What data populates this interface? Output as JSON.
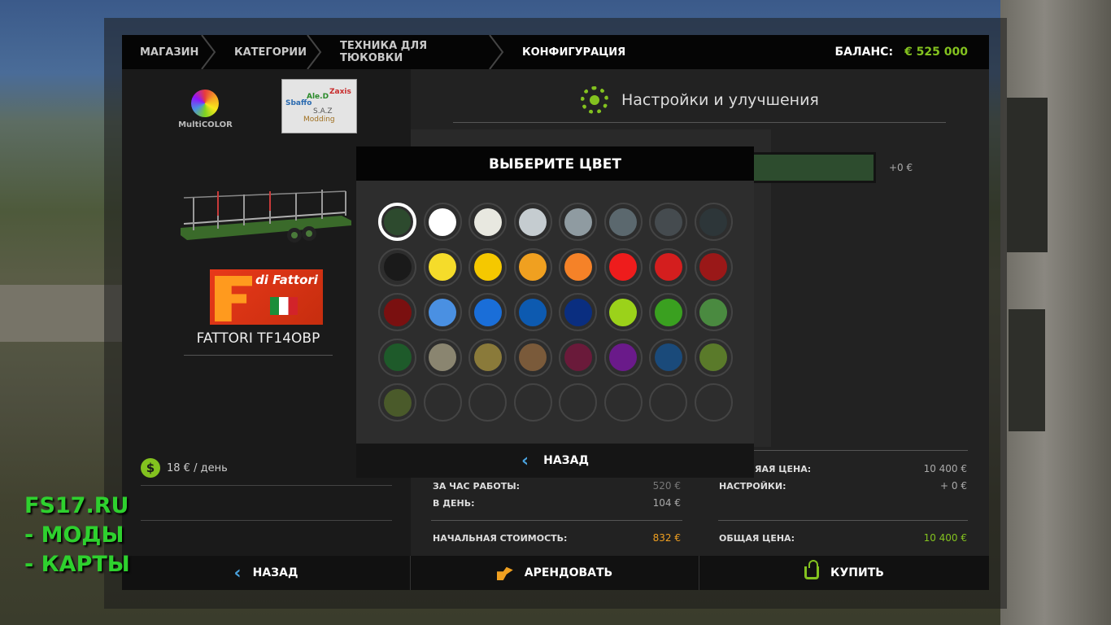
{
  "breadcrumbs": [
    "МАГАЗИН",
    "КАТЕГОРИИ",
    "ТЕХНИКА ДЛЯ ТЮКОВКИ",
    "КОНФИГУРАЦИЯ"
  ],
  "balance": {
    "label": "БАЛАНС:",
    "value": "€ 525 000"
  },
  "left": {
    "multicolor_logo": "MultiCOLOR",
    "sb_logo": [
      "Sbaffo",
      "Ale.D",
      "Zaxis",
      "S.A.Z",
      "Modding"
    ],
    "brand_logo": "di Fattori",
    "vehicle_name": "FATTORI TF14OBP",
    "per_day": "18 € / день"
  },
  "settings": {
    "title": "Настройки и улучшения",
    "price_delta": "+0 €"
  },
  "costs": {
    "per_hour_label": "ЗА ЧАС РАБОТЫ:",
    "per_hour_value": "520 €",
    "per_day_label": "В ДЕНЬ:",
    "per_day_value": "104 €",
    "initial_label": "НАЧАЛЬНАЯ СТОИМОСТЬ:",
    "initial_value": "832 €",
    "base_price_label": "ЯАЯ ЦЕНА:",
    "base_price_value": "10 400 €",
    "config_label": "НАСТРОЙКИ:",
    "config_value": "+ 0 €",
    "total_label": "ОБЩАЯ ЦЕНА:",
    "total_value": "10 400 €"
  },
  "color_picker": {
    "title": "ВЫБЕРИТЕ ЦВЕТ",
    "back_label": "НАЗАД",
    "selected_index": 0,
    "colors": [
      "#2d4a2e",
      "#ffffff",
      "#e8e8e0",
      "#c5ccd0",
      "#8f9ba1",
      "#5b686e",
      "#454b4f",
      "#2d3639",
      "#1a1a1a",
      "#f5dc2a",
      "#f5c800",
      "#f0a020",
      "#f58228",
      "#ee1c1c",
      "#d41e1e",
      "#9a1818",
      "#7a1010",
      "#4a90e2",
      "#1a6ed8",
      "#0d5ab0",
      "#0a2e80",
      "#9bd21a",
      "#3aa020",
      "#4a8a40",
      "#1e5a2a",
      "#8a8570",
      "#8a7a3a",
      "#7a5a3a",
      "#6a1a3a",
      "#6a1a8a",
      "#1a4a7a",
      "#5a7a2a",
      "#4a5a2a",
      "",
      "",
      "",
      "",
      "",
      "",
      ""
    ]
  },
  "bottom": {
    "back": "НАЗАД",
    "rent": "АРЕНДОВАТЬ",
    "buy": "КУПИТЬ"
  },
  "watermark": [
    "FS17.RU",
    " - МОДЫ",
    " - КАРТЫ"
  ]
}
